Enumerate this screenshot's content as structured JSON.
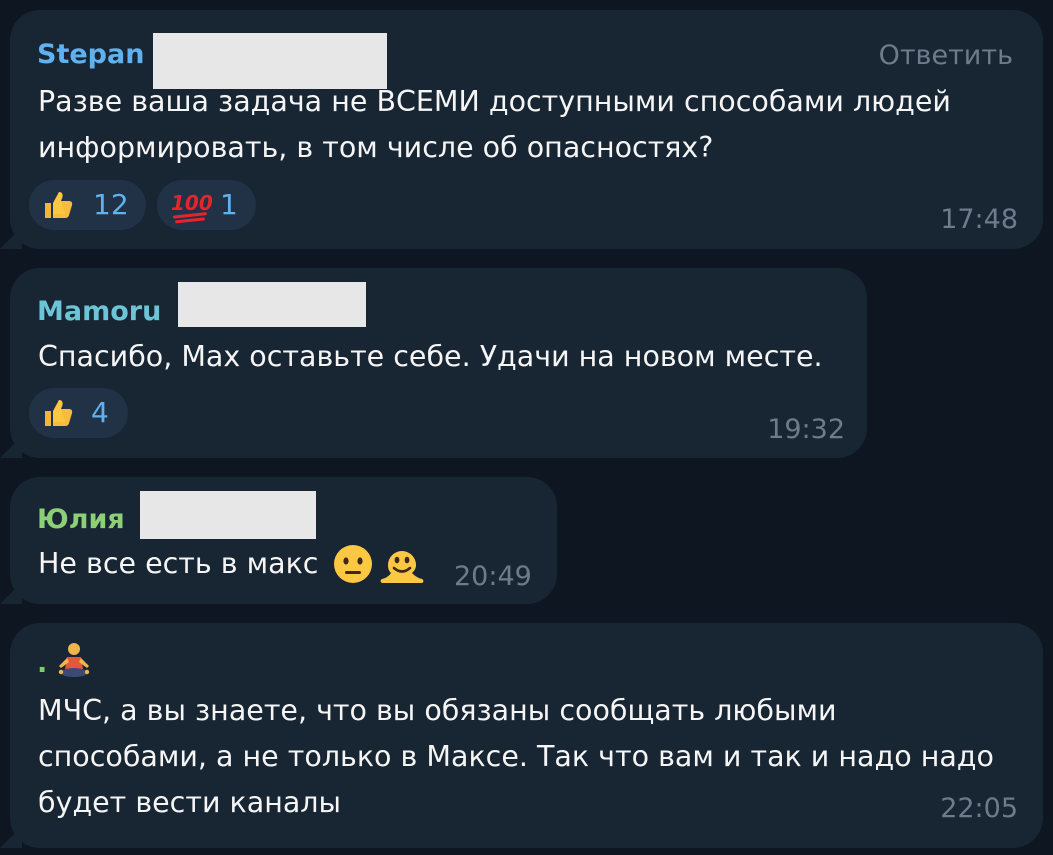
{
  "colors": {
    "background": "#0e1621",
    "bubble": "#182533",
    "reaction_bg": "#213246",
    "reaction_text": "#5fb2ef",
    "time_text": "#6d7c8c",
    "stepan": "#5fb2ef",
    "mamoru": "#6cc5d6",
    "yulia": "#8dcf77",
    "dot": "#7bcf6a"
  },
  "messages": [
    {
      "sender": "Stepan",
      "reply_label": "Ответить",
      "text": "Разве ваша задача не ВСЕМИ доступными способами людей\nинформировать, в том числе об опасностях?",
      "reactions": [
        {
          "icon": "thumbs-up-icon",
          "count": "12"
        },
        {
          "icon": "hundred-points-icon",
          "count": "1"
        }
      ],
      "time": "17:48"
    },
    {
      "sender": "Mamoru",
      "text": "Спасибо, Max оставьте себе. Удачи на новом месте.",
      "reactions": [
        {
          "icon": "thumbs-up-icon",
          "count": "4"
        }
      ],
      "time": "19:32"
    },
    {
      "sender": "Юлия",
      "text": "Не все есть в макс",
      "trailing_emoji": [
        "neutral-face-icon",
        "melting-face-icon"
      ],
      "time": "20:49"
    },
    {
      "sender": ".",
      "sender_emoji": "person-in-lotus-position-icon",
      "text": "МЧС, а вы знаете, что вы обязаны сообщать любыми\nспособами, а не только в Максе. Так что вам и так и надо надо\nбудет вести каналы",
      "time": "22:05"
    }
  ]
}
